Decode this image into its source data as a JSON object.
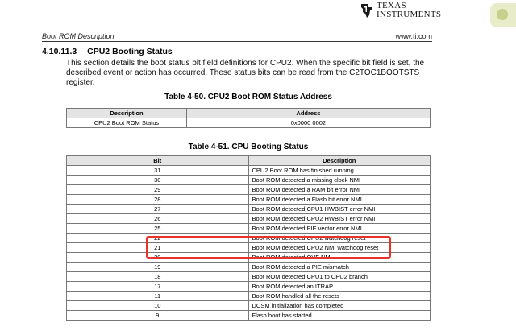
{
  "header": {
    "logo_line1": "TEXAS",
    "logo_line2": "INSTRUMENTS",
    "running_title": "Boot ROM Description",
    "website": "www.ti.com"
  },
  "section": {
    "number": "4.10.11.3",
    "title": "CPU2 Booting Status",
    "paragraph": "This section details the boot status bit field definitions for CPU2. When the specific bit field is set, the described event or action has occurred. These status bits can be read from the C2TOC1BOOTSTS register."
  },
  "table_address": {
    "caption": "Table 4-50. CPU2 Boot ROM Status Address",
    "headers": [
      "Description",
      "Address"
    ],
    "rows": [
      [
        "CPU2 Boot ROM Status",
        "0x0000 0002"
      ]
    ]
  },
  "table_status": {
    "caption": "Table 4-51. CPU Booting Status",
    "headers": [
      "Bit",
      "Description"
    ],
    "rows": [
      [
        "31",
        "CPU2 Boot ROM has finished running"
      ],
      [
        "30",
        "Boot ROM detected a missing clock NMI"
      ],
      [
        "29",
        "Boot ROM detected a RAM bit error NMI"
      ],
      [
        "28",
        "Boot ROM detected a Flash bit error NMI"
      ],
      [
        "27",
        "Boot ROM detected CPU1 HWBIST error NMI"
      ],
      [
        "26",
        "Boot ROM detected CPU2 HWBIST error NMI"
      ],
      [
        "25",
        "Boot ROM detected PIE vector error NMI"
      ],
      [
        "22",
        "Boot ROM detected CPU2 watchdog reset"
      ],
      [
        "21",
        "Boot ROM detected CPU2 NMI watchdog reset"
      ],
      [
        "20",
        "Boot ROM detected OVF NMI"
      ],
      [
        "19",
        "Boot ROM detected a PIE mismatch"
      ],
      [
        "18",
        "Boot ROM detected CPU1 to CPU2 branch"
      ],
      [
        "17",
        "Boot ROM detected an ITRAP"
      ],
      [
        "11",
        "Boot ROM handled all the resets"
      ],
      [
        "10",
        "DCSM initialization has completed"
      ],
      [
        "9",
        "Flash boot has started"
      ]
    ]
  },
  "annotation": {
    "color": "#e8332a"
  },
  "icons": {
    "logo": "ti-logo-icon"
  }
}
